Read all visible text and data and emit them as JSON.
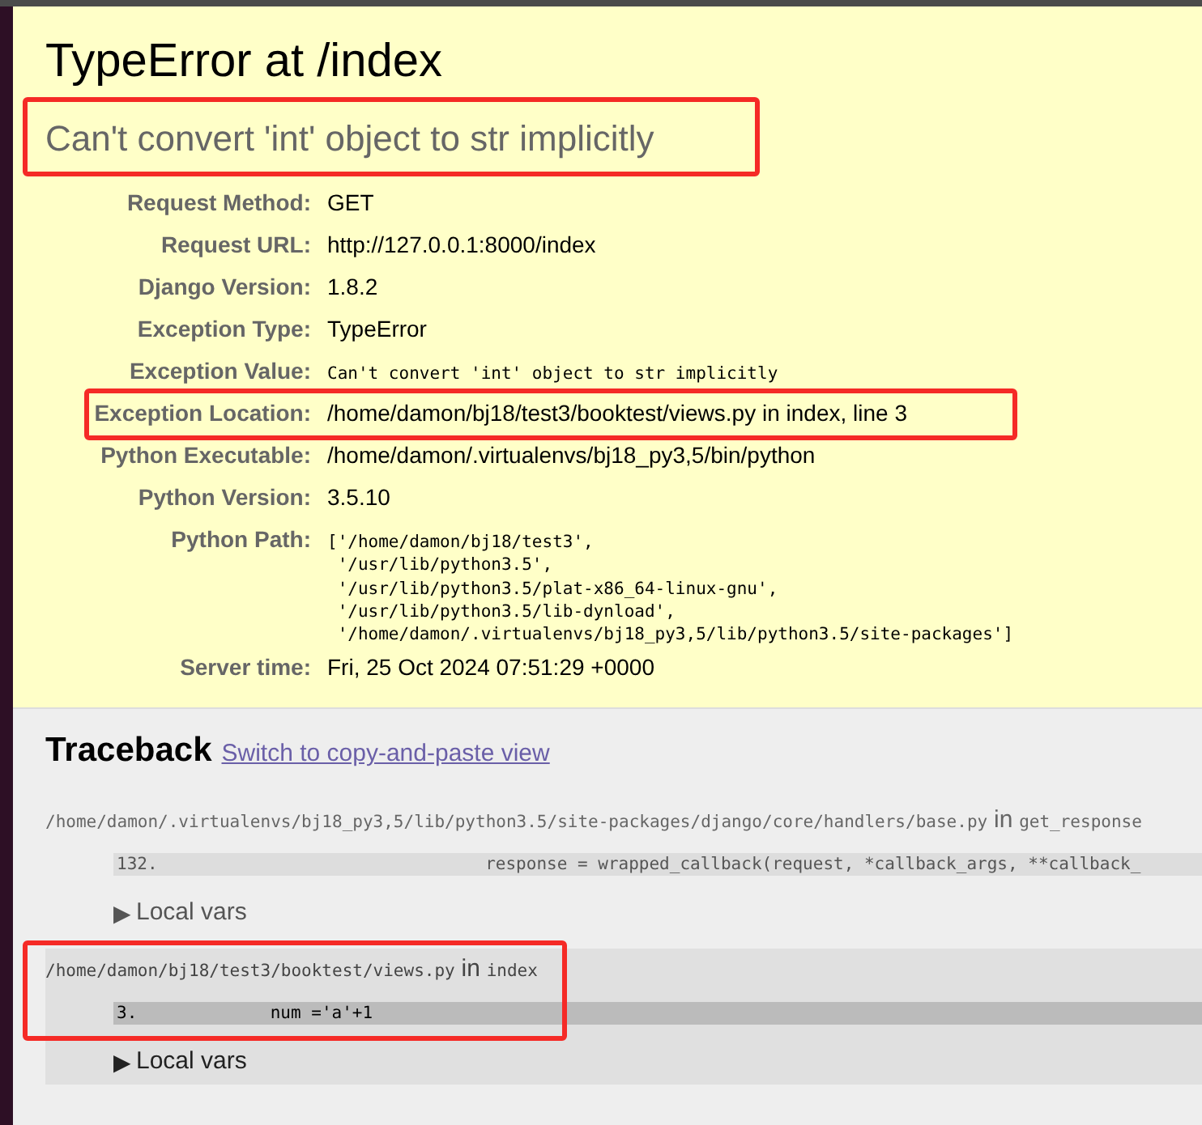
{
  "summary": {
    "title": "TypeError at /index",
    "message": "Can't convert 'int' object to str implicitly",
    "highlighted": true
  },
  "meta": [
    {
      "label": "Request Method:",
      "value": "GET",
      "kind": "text",
      "highlighted": false
    },
    {
      "label": "Request URL:",
      "value": "http://127.0.0.1:8000/index",
      "kind": "text",
      "highlighted": false
    },
    {
      "label": "Django Version:",
      "value": "1.8.2",
      "kind": "text",
      "highlighted": false
    },
    {
      "label": "Exception Type:",
      "value": "TypeError",
      "kind": "text",
      "highlighted": false
    },
    {
      "label": "Exception Value:",
      "value": "Can't convert 'int' object to str implicitly",
      "kind": "code",
      "highlighted": false
    },
    {
      "label": "Exception Location:",
      "value": "/home/damon/bj18/test3/booktest/views.py in index, line 3",
      "kind": "text",
      "highlighted": true
    },
    {
      "label": "Python Executable:",
      "value": "/home/damon/.virtualenvs/bj18_py3,5/bin/python",
      "kind": "text",
      "highlighted": false
    },
    {
      "label": "Python Version:",
      "value": "3.5.10",
      "kind": "text",
      "highlighted": false
    },
    {
      "label": "Python Path:",
      "value": "['/home/damon/bj18/test3',\n '/usr/lib/python3.5',\n '/usr/lib/python3.5/plat-x86_64-linux-gnu',\n '/usr/lib/python3.5/lib-dynload',\n '/home/damon/.virtualenvs/bj18_py3,5/lib/python3.5/site-packages']",
      "kind": "code",
      "highlighted": false
    },
    {
      "label": "Server time:",
      "value": "Fri, 25 Oct 2024 07:51:29 +0000",
      "kind": "text",
      "highlighted": false
    }
  ],
  "traceback": {
    "title": "Traceback",
    "link": "Switch to copy-and-paste view",
    "frames": [
      {
        "kind": "django",
        "file": "/home/damon/.virtualenvs/bj18_py3,5/lib/python3.5/site-packages/django/core/handlers/base.py",
        "joiner": "in",
        "function": "get_response",
        "line_number": "132.",
        "code": "                                response = wrapped_callback(request, *callback_args, **callback_",
        "toggle_icon": "▶",
        "toggle_label": "Local vars",
        "highlighted": false
      },
      {
        "kind": "user",
        "file": "/home/damon/bj18/test3/booktest/views.py",
        "joiner": "in",
        "function": "index",
        "line_number": "3.",
        "code": "             num ='a'+1",
        "toggle_icon": "▶",
        "toggle_label": "Local vars",
        "highlighted": true
      }
    ]
  }
}
